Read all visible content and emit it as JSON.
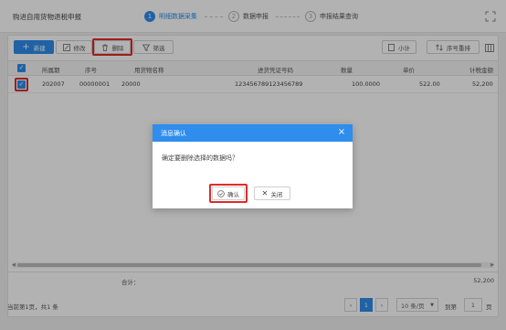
{
  "header": {
    "title": "购进自用货物退税申报",
    "steps": [
      {
        "num": "1",
        "label": "明细数据采集"
      },
      {
        "num": "2",
        "label": "数据申报"
      },
      {
        "num": "3",
        "label": "申报结果查询"
      }
    ],
    "expand_icon": "fullscreen-icon"
  },
  "toolbar": {
    "new_label": "新建",
    "edit_label": "修改",
    "delete_label": "删除",
    "filter_label": "筛选",
    "sum_label": "小计",
    "sort_label": "序号重排"
  },
  "table": {
    "columns": [
      "所属期",
      "序号",
      "用货物名称",
      "进货凭证号码",
      "数量",
      "单价",
      "计税金额"
    ],
    "rows": [
      {
        "period": "202007",
        "seq": "00000001",
        "name": "20000",
        "voucher": "123456789123456789",
        "qty": "100.0000",
        "price": "522.00",
        "amount": "52,200"
      }
    ]
  },
  "footer": {
    "sum_label": "合计：",
    "sum_value": "52,200"
  },
  "pagination": {
    "info": "当前第1页，共1 条",
    "prev": "‹",
    "current": "1",
    "next": "›",
    "page_size": "10 条/页",
    "goto_label": "到第",
    "goto_value": "1",
    "goto_unit": "页"
  },
  "dialog": {
    "title": "消息确认",
    "message": "确定要删除选择的数据吗？",
    "confirm_label": "确认",
    "close_label": "关闭"
  },
  "colors": {
    "accent": "#2e8ded",
    "highlight": "#e02b2b"
  }
}
